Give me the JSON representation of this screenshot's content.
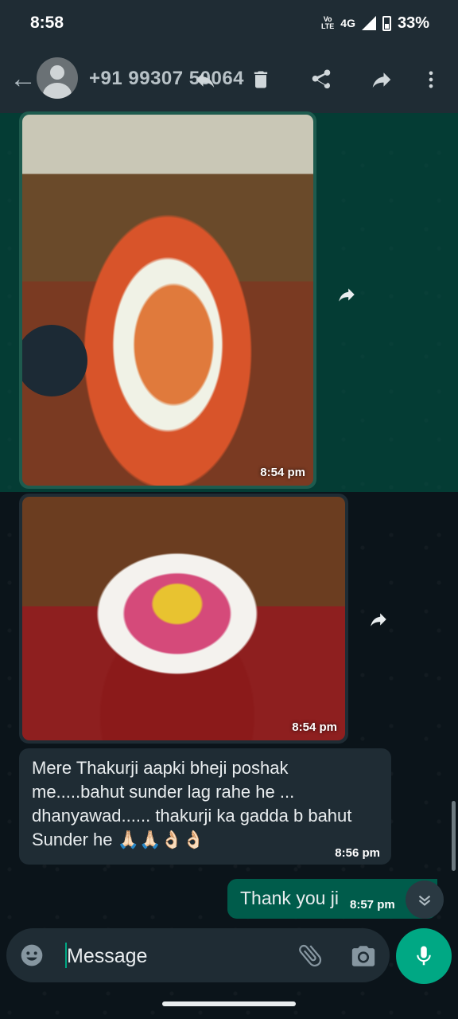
{
  "status_bar": {
    "time": "8:58",
    "volte_top": "Vo",
    "volte_bottom": "LTE",
    "network": "4G",
    "battery": "33%"
  },
  "app_bar": {
    "contact": "+91 99307 50064",
    "icons": [
      "back-arrow-icon",
      "avatar",
      "reply-icon",
      "delete-icon",
      "share-icon",
      "forward-icon",
      "more-vert-icon"
    ]
  },
  "messages": [
    {
      "type": "image",
      "direction": "incoming",
      "time": "8:54 pm",
      "selected": true
    },
    {
      "type": "image",
      "direction": "incoming",
      "time": "8:54 pm",
      "selected": false
    },
    {
      "type": "text",
      "direction": "incoming",
      "lines": [
        "Mere Thakurji aapki bheji poshak",
        "me.....bahut sunder lag rahe he ...",
        "dhanyawad...... thakurji ka gadda b bahut",
        "Sunder he 🙏🏻🙏🏻👌🏻👌🏻"
      ],
      "time": "8:56 pm"
    },
    {
      "type": "text",
      "direction": "outgoing",
      "text": "Thank you ji",
      "time": "8:57 pm"
    }
  ],
  "composer": {
    "placeholder": "Message"
  },
  "colors": {
    "bar": "#1f2c34",
    "background": "#0b141a",
    "outgoing": "#005c4b",
    "accent": "#00a884"
  }
}
